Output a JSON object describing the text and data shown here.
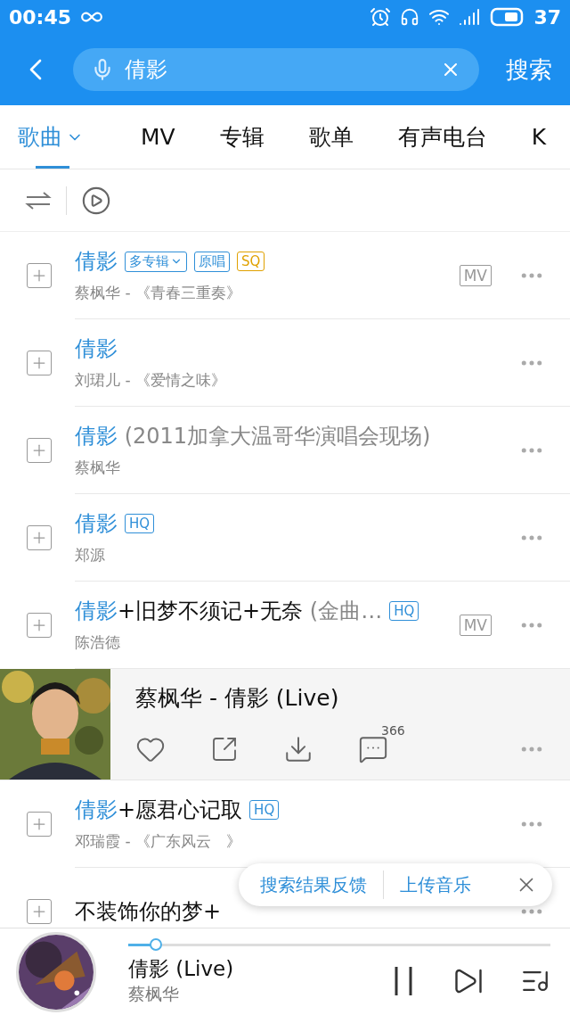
{
  "status_bar": {
    "time": "00:45",
    "battery": "37"
  },
  "search": {
    "value": "倩影",
    "button": "搜索"
  },
  "tabs": [
    {
      "label": "歌曲",
      "selected": true,
      "dropdown": true
    },
    {
      "label": "MV",
      "selected": false,
      "dropdown": false
    },
    {
      "label": "专辑",
      "selected": false,
      "dropdown": false
    },
    {
      "label": "歌单",
      "selected": false,
      "dropdown": false
    },
    {
      "label": "有声电台",
      "selected": false,
      "dropdown": false
    },
    {
      "label": "K",
      "selected": false,
      "dropdown": false
    }
  ],
  "songs": [
    {
      "title": [
        {
          "text": "倩影",
          "kind": "match"
        }
      ],
      "tags": [
        {
          "text": "多专辑",
          "kind": "dropdown",
          "color": "#2f8fd8"
        },
        {
          "text": "原唱",
          "kind": "plain",
          "color": "#2f8fd8"
        },
        {
          "text": "SQ",
          "kind": "plain",
          "color": "#e0a100"
        }
      ],
      "subtitle": "蔡枫华 - 《青春三重奏》",
      "badge": "MV"
    },
    {
      "title": [
        {
          "text": "倩影",
          "kind": "match"
        }
      ],
      "subtitle": "刘珺儿 - 《爱情之味》"
    },
    {
      "title": [
        {
          "text": "倩影",
          "kind": "match"
        },
        {
          "text": " (2011加拿大温哥华演唱会现场)",
          "kind": "note"
        }
      ],
      "subtitle": "蔡枫华"
    },
    {
      "title": [
        {
          "text": "倩影",
          "kind": "match"
        }
      ],
      "tags": [
        {
          "text": "HQ",
          "kind": "plain",
          "color": "#2f8fd8"
        }
      ],
      "subtitle": "郑源"
    },
    {
      "title": [
        {
          "text": "倩影",
          "kind": "match"
        },
        {
          "text": "+旧梦不须记+无奈",
          "kind": "plain"
        },
        {
          "text": " (金曲…",
          "kind": "note"
        }
      ],
      "tags": [
        {
          "text": "HQ",
          "kind": "plain",
          "color": "#2f8fd8"
        }
      ],
      "subtitle": "陈浩德",
      "badge": "MV"
    },
    {
      "kind": "now_playing",
      "title": "蔡枫华 - 倩影 (Live)",
      "comments": "366"
    },
    {
      "title": [
        {
          "text": "倩影",
          "kind": "match"
        },
        {
          "text": "+愿君心记取",
          "kind": "plain"
        }
      ],
      "tags": [
        {
          "text": "HQ",
          "kind": "plain",
          "color": "#2f8fd8"
        }
      ],
      "subtitle": "邓瑞霞 - 《广东风云　》"
    },
    {
      "title": [
        {
          "text": "不装饰你的梦+",
          "kind": "plain"
        }
      ]
    }
  ],
  "feedback_popup": {
    "feedback": "搜索结果反馈",
    "upload": "上传音乐"
  },
  "player": {
    "title": "倩影 (Live)",
    "artist": "蔡枫华",
    "level": 0.05
  }
}
